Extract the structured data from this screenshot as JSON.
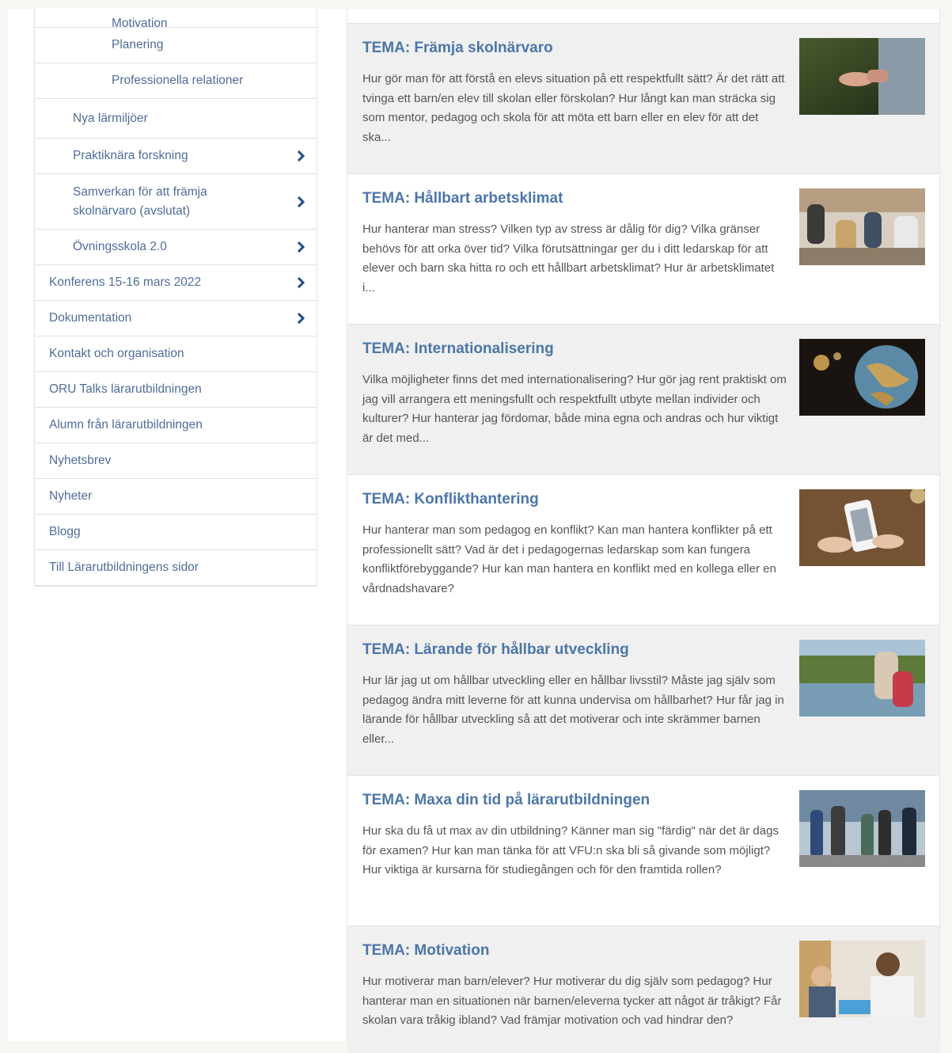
{
  "sidebar": {
    "items": [
      {
        "label": "Motivation",
        "level": 3,
        "chevron": false
      },
      {
        "label": "Planering",
        "level": 3,
        "chevron": false
      },
      {
        "label": "Professionella relationer",
        "level": 3,
        "chevron": false
      },
      {
        "label": "Nya lärmiljöer",
        "level": 2,
        "chevron": false
      },
      {
        "label": "Praktiknära forskning",
        "level": 2,
        "chevron": true
      },
      {
        "label": "Samverkan för att främja skolnärvaro (avslutat)",
        "level": 2,
        "chevron": true
      },
      {
        "label": "Övningsskola 2.0",
        "level": 2,
        "chevron": true
      },
      {
        "label": "Konferens 15-16 mars 2022",
        "level": 1,
        "chevron": true
      },
      {
        "label": "Dokumentation",
        "level": 1,
        "chevron": true
      },
      {
        "label": "Kontakt och organisation",
        "level": 1,
        "chevron": false
      },
      {
        "label": "ORU Talks lärarutbildningen",
        "level": 1,
        "chevron": false
      },
      {
        "label": "Alumn från lärarutbildningen",
        "level": 1,
        "chevron": false
      },
      {
        "label": "Nyhetsbrev",
        "level": 1,
        "chevron": false
      },
      {
        "label": "Nyheter",
        "level": 1,
        "chevron": false
      },
      {
        "label": "Blogg",
        "level": 1,
        "chevron": false
      },
      {
        "label": "Till Lärarutbildningens sidor",
        "level": 1,
        "chevron": false
      }
    ]
  },
  "cards": [
    {
      "title": "TEMA: Främja skolnärvaro",
      "text": "Hur gör man för att förstå en elevs situation på ett respektfullt sätt? Är det rätt att tvinga ett barn/en elev till skolan eller förskolan? Hur långt kan man sträcka sig som mentor, pedagog och skola för att möta ett barn eller en elev för att det ska...",
      "image_icon": "outstretched-hand-photo"
    },
    {
      "title": "TEMA: Hållbart arbetsklimat",
      "text": "Hur hanterar man stress? Vilken typ av stress är dålig för dig? Vilka gränser behövs för att orka över tid? Vilka förutsättningar ger du i ditt ledarskap för att elever och barn ska hitta ro och ett hållbart arbetsklimat? Hur är arbetsklimatet i...",
      "image_icon": "meeting-room-photo"
    },
    {
      "title": "TEMA: Internationalisering",
      "text": "Vilka möjligheter finns det med internationalisering? Hur gör jag rent praktiskt om jag vill arrangera ett meningsfullt och respektfullt utbyte mellan individer och kulturer? Hur hanterar jag fördomar, både mina egna och andras och hur viktigt är det med...",
      "image_icon": "globe-photo"
    },
    {
      "title": "TEMA: Konflikthantering",
      "text": "Hur hanterar man som pedagog en konflikt? Kan man hantera konflikter på ett professionellt sätt? Vad är det i pedagogernas ledarskap som kan fungera konfliktförebyggande? Hur kan man hantera en konflikt med en kollega eller en vårdnadshavare?",
      "image_icon": "phone-in-hands-photo"
    },
    {
      "title": "TEMA: Lärande för hållbar utveckling",
      "text": "Hur lär jag ut om hållbar utveckling eller en hållbar livsstil? Måste jag själv som pedagog ändra mitt leverne för att kunna undervisa om hållbarhet? Hur får jag in lärande för hållbar utveckling så att det motiverar och inte skrämmer barnen eller...",
      "image_icon": "lakeside-people-photo"
    },
    {
      "title": "TEMA: Maxa din tid på lärarutbildningen",
      "text": "Hur ska du få ut max av din utbildning? Känner man sig \"färdig\" när det är dags för examen? Hur kan man tänka för att VFU:n ska bli så givande som möjligt? Hur viktiga är kursarna för studiegången och för den framtida rollen?",
      "image_icon": "students-walking-photo"
    },
    {
      "title": "TEMA: Motivation",
      "text": "Hur motiverar man barn/elever? Hur motiverar du dig själv som pedagog? Hur hanterar man en situationen när barnen/eleverna tycker att något är tråkigt? Får skolan vara tråkig ibland? Vad främjar motivation och vad hindrar den?",
      "image_icon": "teacher-and-child-photo"
    }
  ],
  "colors": {
    "link": "#4c76a8",
    "nav_text": "#4f6d99",
    "chevron": "#1f4e8c",
    "card_alt_bg": "#f0f0f0",
    "page_bg": "#f8f6f3"
  }
}
